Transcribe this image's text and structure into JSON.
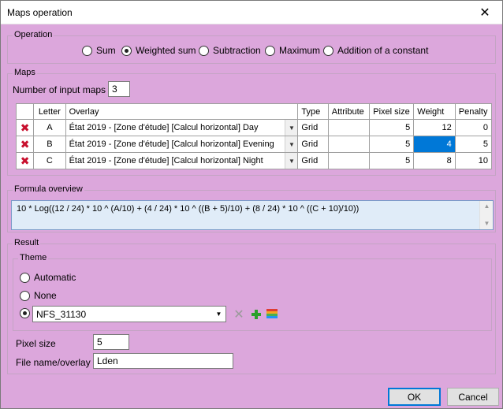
{
  "window": {
    "title": "Maps operation"
  },
  "operation": {
    "label": "Operation",
    "options": [
      "Sum",
      "Weighted sum",
      "Subtraction",
      "Maximum",
      "Addition of a constant"
    ],
    "selected": "Weighted sum"
  },
  "maps": {
    "label": "Maps",
    "count_label": "Number of input maps",
    "count_value": "3",
    "columns": [
      "Letter",
      "Overlay",
      "Type",
      "Attribute",
      "Pixel size",
      "Weight",
      "Penalty"
    ],
    "rows": [
      {
        "letter": "A",
        "overlay": "État 2019 - [Zone d'étude] [Calcul horizontal] Day",
        "type": "Grid",
        "attribute": "",
        "pixel_size": "5",
        "weight": "12",
        "penalty": "0"
      },
      {
        "letter": "B",
        "overlay": "État 2019 - [Zone d'étude] [Calcul horizontal] Evening",
        "type": "Grid",
        "attribute": "",
        "pixel_size": "5",
        "weight": "4",
        "penalty": "5"
      },
      {
        "letter": "C",
        "overlay": "État 2019 - [Zone d'étude] [Calcul horizontal] Night",
        "type": "Grid",
        "attribute": "",
        "pixel_size": "5",
        "weight": "8",
        "penalty": "10"
      }
    ]
  },
  "formula": {
    "label": "Formula overview",
    "text": "10 * Log((12 / 24) * 10 ^ (A/10) + (4 / 24) * 10 ^ ((B + 5)/10) + (8 / 24) * 10 ^ ((C + 10)/10))"
  },
  "result": {
    "label": "Result",
    "theme_label": "Theme",
    "theme_options": [
      "Automatic",
      "None"
    ],
    "theme_selected_value": "NFS_31130",
    "pixel_size_label": "Pixel size",
    "pixel_size_value": "5",
    "file_label": "File name/overlay",
    "file_value": "Lden"
  },
  "buttons": {
    "ok": "OK",
    "cancel": "Cancel"
  },
  "colors": {
    "background": "#dca7dc",
    "selection": "#0078d7",
    "delete": "#c8102e",
    "add": "#2ca02c"
  }
}
